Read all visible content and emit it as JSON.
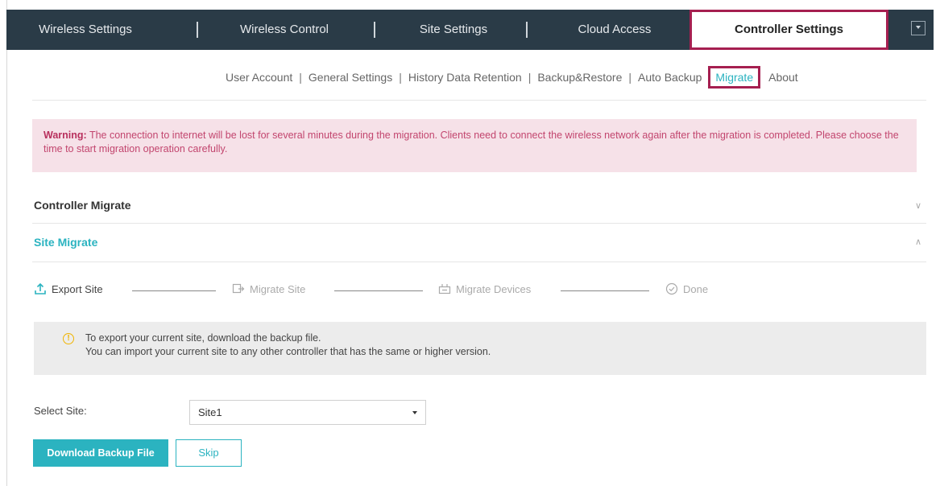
{
  "topnav": {
    "tabs": [
      {
        "label": "Wireless Settings"
      },
      {
        "label": "Wireless Control"
      },
      {
        "label": "Site Settings"
      },
      {
        "label": "Cloud Access"
      },
      {
        "label": "Controller Settings",
        "active": true
      }
    ]
  },
  "subnav": {
    "items": [
      "User Account",
      "General Settings",
      "History Data Retention",
      "Backup&Restore",
      "Auto Backup",
      "Migrate",
      "About"
    ],
    "active": "Migrate"
  },
  "warning": {
    "prefix": "Warning:",
    "text": " The connection to internet will be lost for several minutes during the migration. Clients need to connect the wireless network again after the migration is completed. Please choose the time to start migration operation carefully."
  },
  "sections": {
    "controller_migrate": "Controller Migrate",
    "site_migrate": "Site Migrate"
  },
  "steps": [
    {
      "label": "Export Site",
      "icon": "upload-icon",
      "state": "current"
    },
    {
      "label": "Migrate Site",
      "icon": "migrate-site-icon",
      "state": "pending"
    },
    {
      "label": "Migrate Devices",
      "icon": "migrate-devices-icon",
      "state": "pending"
    },
    {
      "label": "Done",
      "icon": "check-circle-icon",
      "state": "pending"
    }
  ],
  "info": {
    "line1": "To export your current site, download the backup file.",
    "line2": "You can import your current site to any other controller that has the same or higher version."
  },
  "form": {
    "select_site_label": "Select Site:",
    "select_site_value": "Site1"
  },
  "buttons": {
    "download": "Download Backup File",
    "skip": "Skip"
  },
  "colors": {
    "nav_bg": "#2a3b47",
    "accent": "#2bb3c0",
    "highlight": "#a51f50",
    "warning_bg": "#f6e1e8",
    "warning_text": "#c2456e"
  }
}
